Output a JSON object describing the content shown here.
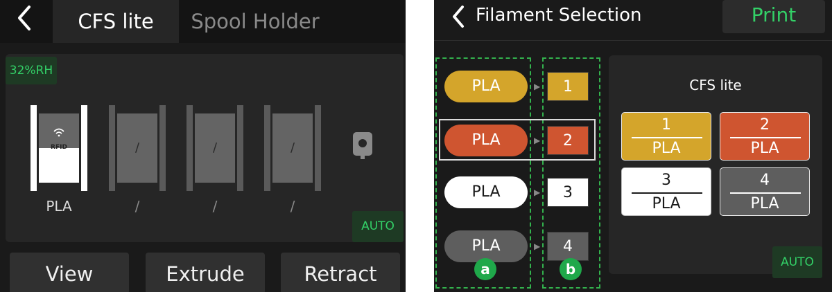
{
  "left": {
    "back_icon": "chevron-left-icon",
    "tabs": [
      {
        "label": "CFS lite",
        "active": true
      },
      {
        "label": "Spool Holder",
        "active": false
      }
    ],
    "humidity": "32%RH",
    "slots": [
      {
        "slot_text": "",
        "rfid": "RFID",
        "label": "PLA",
        "active": true
      },
      {
        "slot_text": "/",
        "label": "/",
        "active": false
      },
      {
        "slot_text": "/",
        "label": "/",
        "active": false
      },
      {
        "slot_text": "/",
        "label": "/",
        "active": false
      }
    ],
    "spool_holder_icon": "spool-holder-icon",
    "auto_label": "AUTO",
    "buttons": [
      "View",
      "Extrude",
      "Retract"
    ]
  },
  "right": {
    "back_icon": "chevron-left-icon",
    "title": "Filament Selection",
    "print_label": "Print",
    "filaments": [
      {
        "material": "PLA",
        "color": "#d4a52b",
        "text_color": "#ffffff"
      },
      {
        "material": "PLA",
        "color": "#cf5530",
        "text_color": "#ffffff"
      },
      {
        "material": "PLA",
        "color": "#ffffff",
        "text_color": "#1a1a1a"
      },
      {
        "material": "PLA",
        "color": "#5e5e5e",
        "text_color": "#ffffff"
      }
    ],
    "slot_numbers": [
      "1",
      "2",
      "3",
      "4"
    ],
    "callouts": [
      "a",
      "b"
    ],
    "cfs_title": "CFS lite",
    "cfs_slots": [
      {
        "number": "1",
        "material": "PLA",
        "color": "#d4a52b",
        "text_color": "#ffffff"
      },
      {
        "number": "2",
        "material": "PLA",
        "color": "#cf5530",
        "text_color": "#ffffff"
      },
      {
        "number": "3",
        "material": "PLA",
        "color": "#ffffff",
        "text_color": "#1a1a1a"
      },
      {
        "number": "4",
        "material": "PLA",
        "color": "#5e5e5e",
        "text_color": "#ffffff"
      }
    ],
    "auto_label": "AUTO"
  },
  "colors": {
    "accent_green": "#33d067",
    "callout_green": "#1fa84a"
  }
}
